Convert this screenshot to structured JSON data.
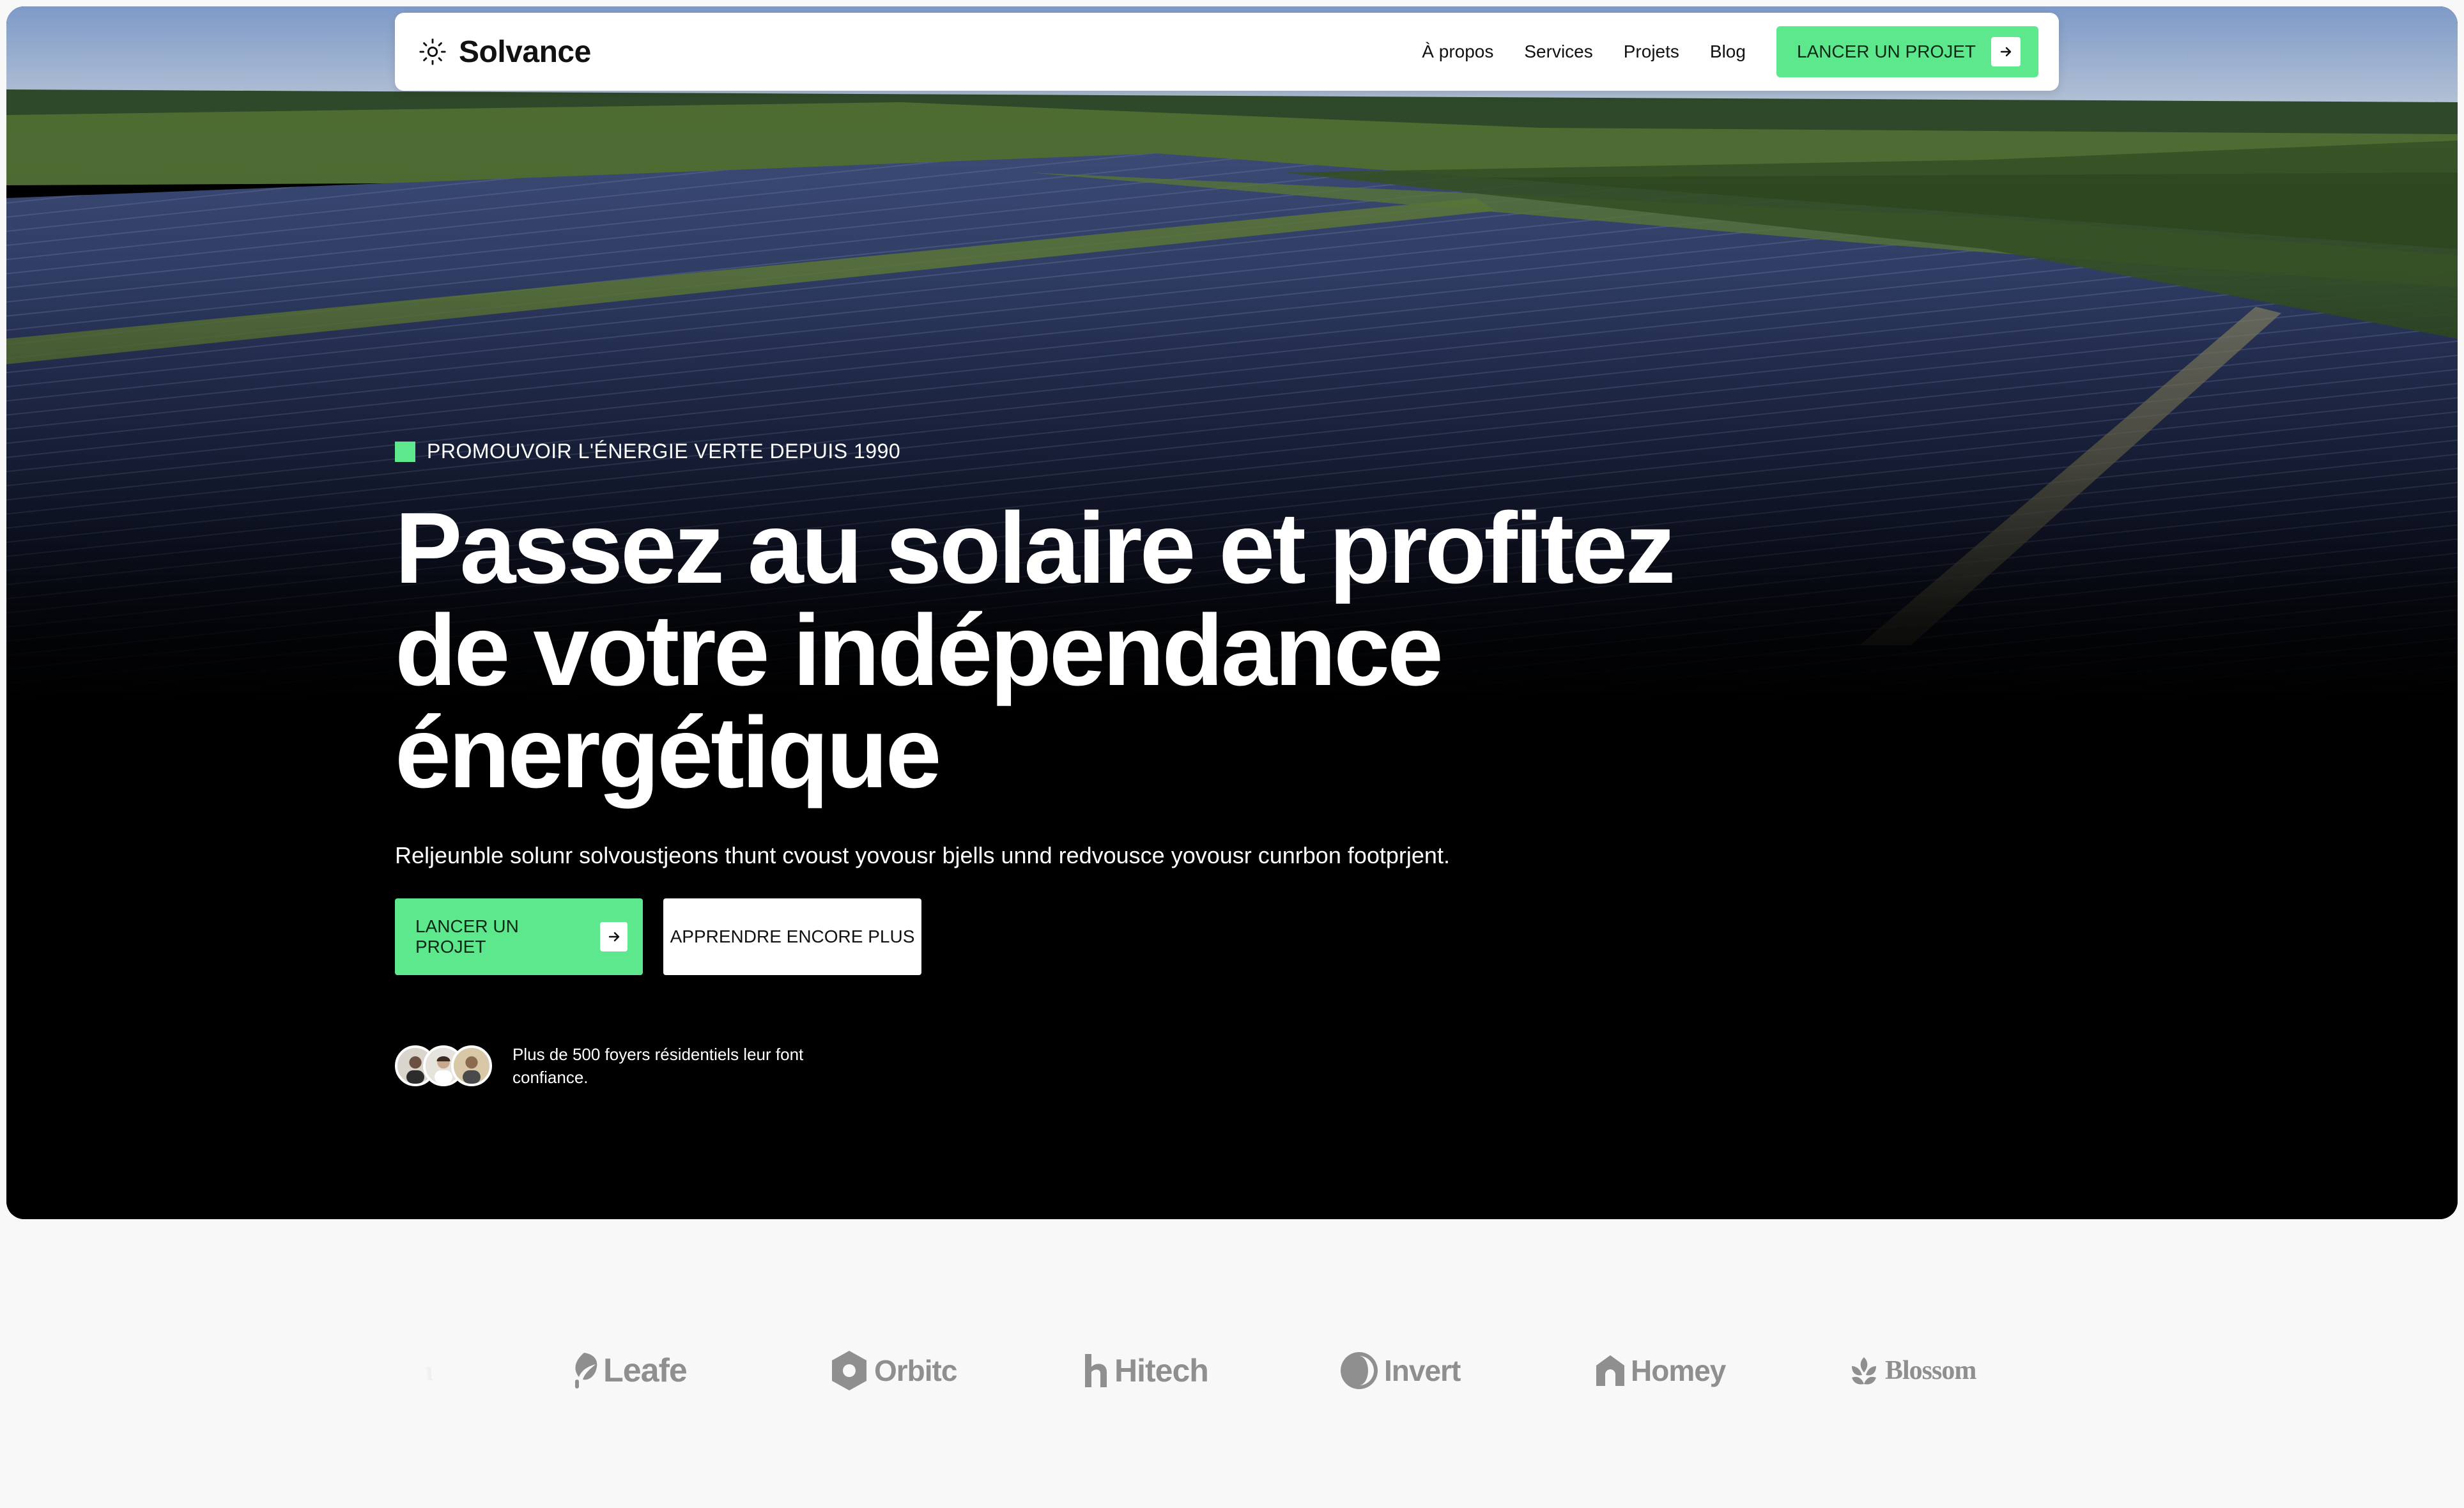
{
  "colors": {
    "accent": "#5ee88e",
    "hero_bg": "#000000",
    "page_bg": "#f8f8f8",
    "logo_gray": "#8f8f8f"
  },
  "nav": {
    "brand": "Solvance",
    "brand_icon": "sun-icon",
    "links": [
      "À propos",
      "Services",
      "Projets",
      "Blog"
    ],
    "cta_label": "LANCER UN PROJET",
    "cta_icon": "arrow-right-icon"
  },
  "hero": {
    "eyebrow": "PROMOUVOIR L'ÉNERGIE VERTE DEPUIS 1990",
    "headline_lines": [
      "Passez au solaire et profitez",
      "de votre indépendance",
      "énergétique"
    ],
    "subtext": "Reljeunble solunr solvoustjeons thunt cvoust yovousr bjells unnd redvousce yovousr cunrbon footprjent.",
    "primary_button": "LANCER UN PROJET",
    "secondary_button": "APPRENDRE ENCORE PLUS",
    "trust_text": "Plus de 500 foyers résidentiels leur font confiance."
  },
  "logos": [
    {
      "name": "om",
      "icon": "blossom-icon"
    },
    {
      "name": "Leafe",
      "icon": "leaf-icon"
    },
    {
      "name": "Orbitc",
      "icon": "orbit-icon"
    },
    {
      "name": "Hitech",
      "icon": "hitech-icon"
    },
    {
      "name": "Invert",
      "icon": "invert-icon"
    },
    {
      "name": "Homey",
      "icon": "home-icon"
    },
    {
      "name": "Blossom",
      "icon": "blossom-icon"
    }
  ]
}
